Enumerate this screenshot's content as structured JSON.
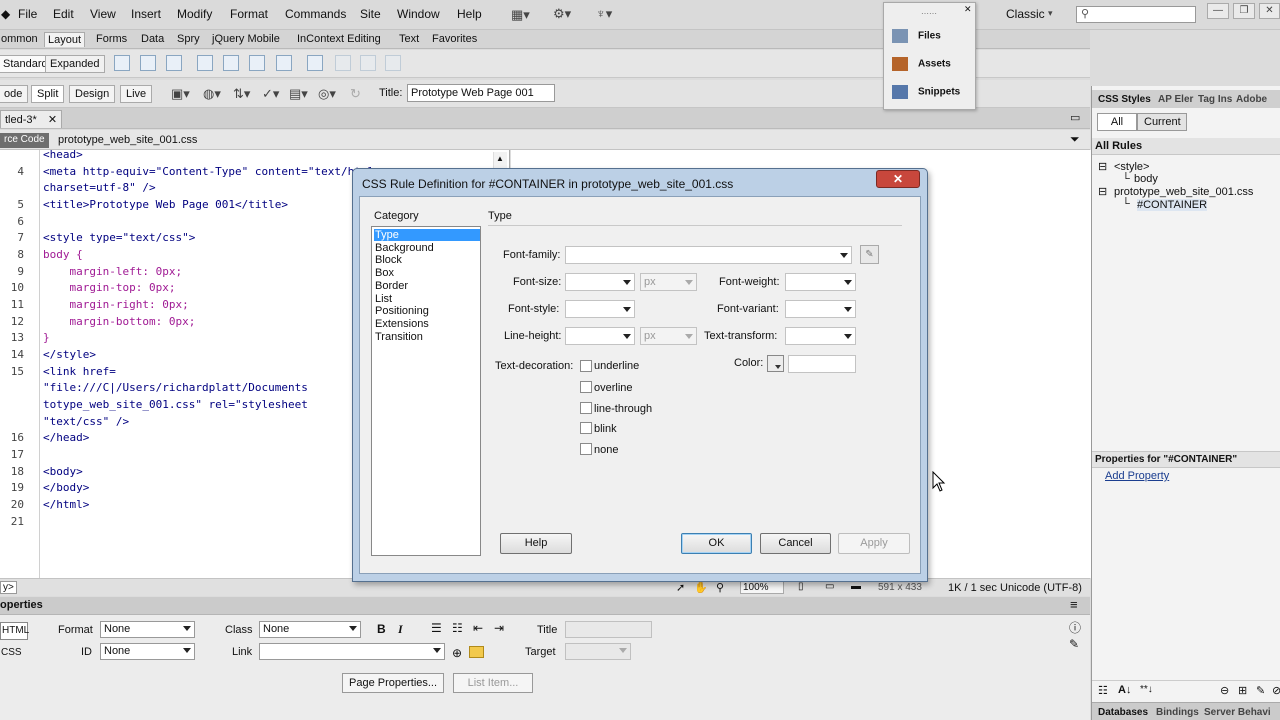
{
  "menubar": {
    "items": [
      "File",
      "Edit",
      "View",
      "Insert",
      "Modify",
      "Format",
      "Commands",
      "Site",
      "Window",
      "Help"
    ],
    "workspace": "Classic"
  },
  "insert_tabs": [
    "ommon",
    "Layout",
    "Forms",
    "Data",
    "Spry",
    "jQuery Mobile",
    "InContext Editing",
    "Text",
    "Favorites"
  ],
  "insert_bar": {
    "standard": "Standard",
    "expanded": "Expanded"
  },
  "view_buttons": {
    "code": "ode",
    "split": "Split",
    "design": "Design",
    "live": "Live"
  },
  "title_label": "Title:",
  "title_value": "Prototype Web Page 001",
  "doc_tab": "tled-3*",
  "source_code": "rce Code",
  "related_file": "prototype_web_site_001.css",
  "code_lines": [
    {
      "num": "",
      "text": "<head>"
    },
    {
      "num": "4",
      "text": "<meta http-equiv=\"Content-Type\" content=\"text/html;"
    },
    {
      "num": "",
      "text": "charset=utf-8\" />"
    },
    {
      "num": "5",
      "text": "<title>Prototype Web Page 001</title>"
    },
    {
      "num": "6",
      "text": ""
    },
    {
      "num": "7",
      "text": "<style type=\"text/css\">"
    },
    {
      "num": "8",
      "text": "body {"
    },
    {
      "num": "9",
      "text": "    margin-left: 0px;"
    },
    {
      "num": "10",
      "text": "    margin-top: 0px;"
    },
    {
      "num": "11",
      "text": "    margin-right: 0px;"
    },
    {
      "num": "12",
      "text": "    margin-bottom: 0px;"
    },
    {
      "num": "13",
      "text": "}"
    },
    {
      "num": "14",
      "text": "</style>"
    },
    {
      "num": "15",
      "text": "<link href="
    },
    {
      "num": "",
      "text": "\"file:///C|/Users/richardplatt/Documents"
    },
    {
      "num": "",
      "text": "totype_web_site_001.css\" rel=\"stylesheet"
    },
    {
      "num": "",
      "text": "\"text/css\" />"
    },
    {
      "num": "16",
      "text": "</head>"
    },
    {
      "num": "17",
      "text": ""
    },
    {
      "num": "18",
      "text": "<body>"
    },
    {
      "num": "19",
      "text": "</body>"
    },
    {
      "num": "20",
      "text": "</html>"
    },
    {
      "num": "21",
      "text": ""
    }
  ],
  "status": {
    "tag": "y>",
    "zoom": "100%",
    "size": "591 x 433",
    "download": "1K / 1 sec",
    "encoding": "Unicode (UTF-8)"
  },
  "properties": {
    "header": "operties",
    "html_btn": "HTML",
    "css_btn": "CSS",
    "format_label": "Format",
    "format_value": "None",
    "id_label": "ID",
    "id_value": "None",
    "class_label": "Class",
    "class_value": "None",
    "link_label": "Link",
    "title_label": "Title",
    "target_label": "Target",
    "page_props_btn": "Page Properties...",
    "list_item_btn": "List Item..."
  },
  "files_panel": {
    "files": "Files",
    "assets": "Assets",
    "snippets": "Snippets"
  },
  "css_panel": {
    "tabs": [
      "CSS Styles",
      "AP Eler",
      "Tag Ins",
      "Adobe"
    ],
    "all": "All",
    "current": "Current",
    "all_rules": "All Rules",
    "tree": [
      "<style>",
      "body",
      "prototype_web_site_001.css",
      "#CONTAINER"
    ],
    "props_for": "Properties for \"#CONTAINER\"",
    "add_property": "Add Property",
    "bottom_tabs": [
      "Databases",
      "Bindings",
      "Server Behavi"
    ]
  },
  "dialog": {
    "title": "CSS Rule Definition for #CONTAINER in prototype_web_site_001.css",
    "category_label": "Category",
    "section_title": "Type",
    "categories": [
      "Type",
      "Background",
      "Block",
      "Box",
      "Border",
      "List",
      "Positioning",
      "Extensions",
      "Transition"
    ],
    "font_family": "Font-family:",
    "font_size": "Font-size:",
    "font_weight": "Font-weight:",
    "font_style": "Font-style:",
    "font_variant": "Font-variant:",
    "line_height": "Line-height:",
    "text_transform": "Text-transform:",
    "text_decoration": "Text-decoration:",
    "color": "Color:",
    "unit": "px",
    "decorations": [
      "underline",
      "overline",
      "line-through",
      "blink",
      "none"
    ],
    "help": "Help",
    "ok": "OK",
    "cancel": "Cancel",
    "apply": "Apply"
  }
}
